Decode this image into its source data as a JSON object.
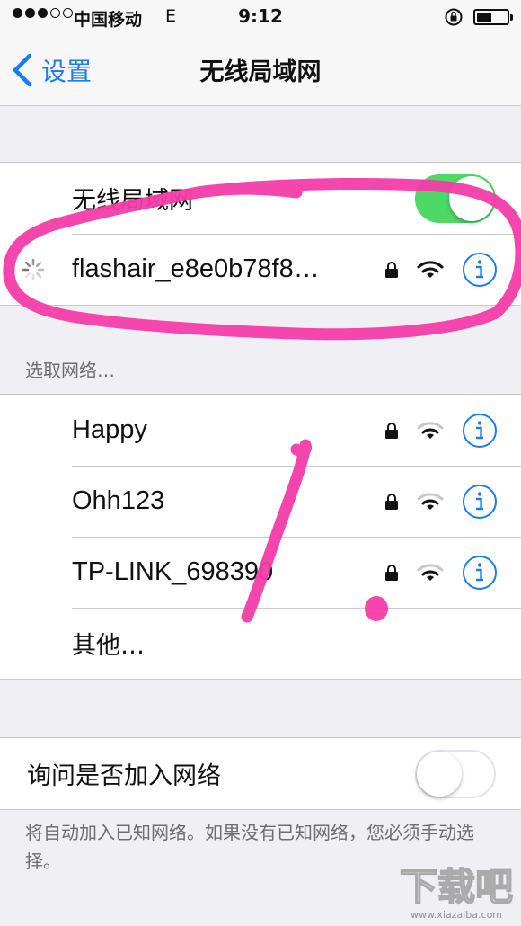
{
  "status_bar": {
    "carrier": "中国移动",
    "network_type": "E",
    "time": "9:12"
  },
  "nav": {
    "back_label": "设置",
    "title": "无线局域网"
  },
  "wifi_toggle": {
    "label": "无线局域网",
    "state": "on"
  },
  "connected_network": {
    "name": "flashair_e8e0b78f8…",
    "secured": true,
    "connecting": true
  },
  "choose_network_header": "选取网络…",
  "networks": [
    {
      "name": "Happy",
      "secured": true
    },
    {
      "name": "Ohh123",
      "secured": true
    },
    {
      "name": "TP-LINK_698390",
      "secured": true
    }
  ],
  "other_label": "其他…",
  "ask_to_join": {
    "label": "询问是否加入网络",
    "state": "off"
  },
  "footer_note": "将自动加入已知网络。如果没有已知网络，您必须手动选择。",
  "watermark": {
    "text": "下载吧",
    "url_text": "www.xiazaiba.com"
  },
  "colors": {
    "accent": "#1b7cf2",
    "toggle_on": "#4cd964",
    "annotation": "#f33ca8",
    "background": "#efeff4"
  },
  "icons": {
    "back": "chevron-left-icon",
    "lock": "lock-icon",
    "wifi": "wifi-icon",
    "info": "info-icon",
    "spinner": "loading-spinner-icon",
    "rotation_lock": "rotation-lock-icon",
    "battery": "battery-icon"
  }
}
